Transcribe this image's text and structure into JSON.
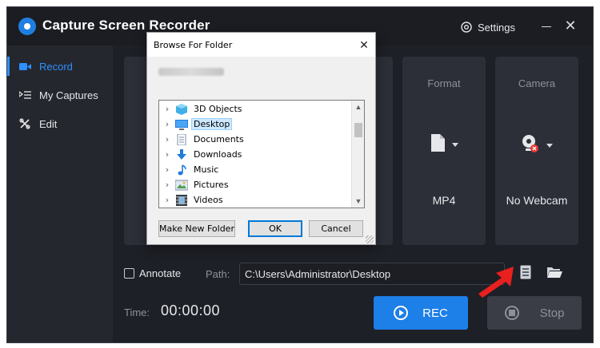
{
  "app": {
    "title": "Capture Screen Recorder",
    "settings_label": "Settings",
    "accent_color": "#1d7fe8"
  },
  "sidebar": {
    "items": [
      {
        "label": "Record",
        "icon": "video-camera-icon",
        "active": true
      },
      {
        "label": "My Captures",
        "icon": "list-icon",
        "active": false
      },
      {
        "label": "Edit",
        "icon": "tools-icon",
        "active": false
      }
    ]
  },
  "panels": {
    "format": {
      "title": "Format",
      "value": "MP4",
      "icon": "file-icon"
    },
    "camera": {
      "title": "Camera",
      "value": "No Webcam",
      "icon": "webcam-off-icon"
    }
  },
  "controls": {
    "annotate_label": "Annotate",
    "annotate_checked": false,
    "path_label": "Path:",
    "path_value": "C:\\Users\\Administrator\\Desktop",
    "time_label": "Time:",
    "time_value": "00:00:00",
    "rec_label": "REC",
    "stop_label": "Stop"
  },
  "dialog": {
    "title": "Browse For Folder",
    "tree": [
      {
        "label": "3D Objects",
        "icon": "3d-objects-icon",
        "selected": false
      },
      {
        "label": "Desktop",
        "icon": "desktop-icon",
        "selected": true
      },
      {
        "label": "Documents",
        "icon": "documents-icon",
        "selected": false
      },
      {
        "label": "Downloads",
        "icon": "downloads-icon",
        "selected": false
      },
      {
        "label": "Music",
        "icon": "music-icon",
        "selected": false
      },
      {
        "label": "Pictures",
        "icon": "pictures-icon",
        "selected": false
      },
      {
        "label": "Videos",
        "icon": "videos-icon",
        "selected": false
      }
    ],
    "buttons": {
      "new_folder": "Make New Folder",
      "ok": "OK",
      "cancel": "Cancel"
    }
  }
}
